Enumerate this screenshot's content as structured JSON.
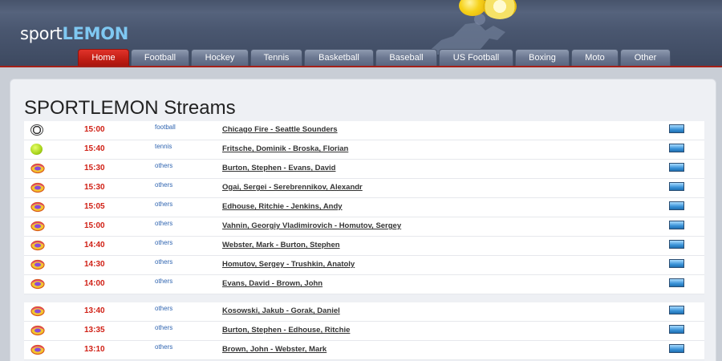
{
  "header": {
    "logo_part1": "sport",
    "logo_part2": "LEMON",
    "nav": [
      {
        "label": "Home",
        "active": true
      },
      {
        "label": "Football"
      },
      {
        "label": "Hockey"
      },
      {
        "label": "Tennis"
      },
      {
        "label": "Basketball"
      },
      {
        "label": "Baseball"
      },
      {
        "label": "US Football"
      },
      {
        "label": "Boxing"
      },
      {
        "label": "Moto"
      },
      {
        "label": "Other"
      }
    ]
  },
  "main": {
    "title": "SPORTLEMON Streams",
    "rows": [
      {
        "icon": "soccer-ball-icon",
        "time": "15:00",
        "category": "football",
        "match": "Chicago Fire - Seattle Sounders"
      },
      {
        "icon": "tennis-ball-icon",
        "time": "15:40",
        "category": "tennis",
        "match": "Fritsche, Dominik - Broska, Florian"
      },
      {
        "icon": "others-sport-icon",
        "time": "15:30",
        "category": "others",
        "match": "Burton, Stephen - Evans, David"
      },
      {
        "icon": "others-sport-icon",
        "time": "15:30",
        "category": "others",
        "match": "Ogai, Sergei - Serebrennikov, Alexandr"
      },
      {
        "icon": "others-sport-icon",
        "time": "15:05",
        "category": "others",
        "match": "Edhouse, Ritchie - Jenkins, Andy"
      },
      {
        "icon": "others-sport-icon",
        "time": "15:00",
        "category": "others",
        "match": "Vahnin, Georgiy Vladimirovich - Homutov, Sergey"
      },
      {
        "icon": "others-sport-icon",
        "time": "14:40",
        "category": "others",
        "match": "Webster, Mark - Burton, Stephen"
      },
      {
        "icon": "others-sport-icon",
        "time": "14:30",
        "category": "others",
        "match": "Homutov, Sergey - Trushkin, Anatoly"
      },
      {
        "icon": "others-sport-icon",
        "time": "14:00",
        "category": "others",
        "match": "Evans, David - Brown, John"
      },
      {
        "icon": "others-sport-icon",
        "time": "13:40",
        "category": "others",
        "match": "Kosowski, Jakub - Gorak, Daniel"
      },
      {
        "icon": "others-sport-icon",
        "time": "13:35",
        "category": "others",
        "match": "Burton, Stephen - Edhouse, Ritchie"
      },
      {
        "icon": "others-sport-icon",
        "time": "13:10",
        "category": "others",
        "match": "Brown, John - Webster, Mark"
      }
    ]
  },
  "colors": {
    "accent_red": "#c01d14",
    "logo_blue": "#7fc8f2",
    "category_blue": "#2f64b0"
  }
}
